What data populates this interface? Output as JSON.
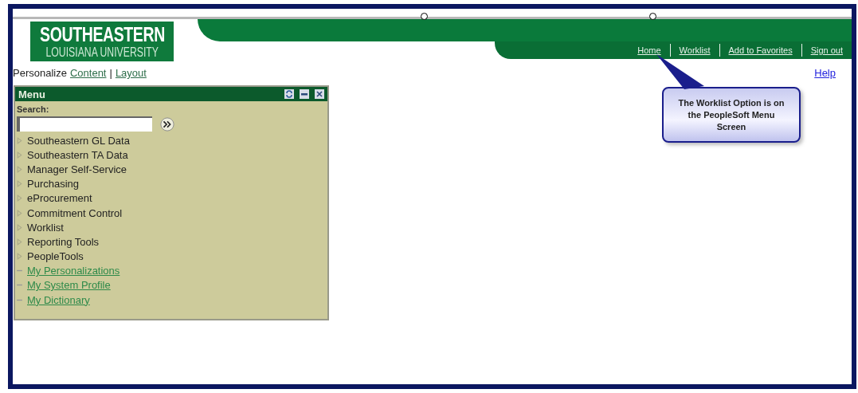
{
  "logo": {
    "title": "SOUTHEASTERN",
    "subtitle": "LOUISIANA UNIVERSITY"
  },
  "nav_links": [
    "Home",
    "Worklist",
    "Add to Favorites",
    "Sign out"
  ],
  "personalize": {
    "label": "Personalize",
    "links": [
      "Content",
      "Layout"
    ],
    "separator": "|"
  },
  "help_link": "Help",
  "menu": {
    "title": "Menu",
    "search": {
      "label": "Search:"
    },
    "items": [
      {
        "kind": "folder",
        "label": "Southeastern GL Data"
      },
      {
        "kind": "folder",
        "label": "Southeastern TA Data"
      },
      {
        "kind": "folder",
        "label": "Manager Self-Service"
      },
      {
        "kind": "folder",
        "label": "Purchasing"
      },
      {
        "kind": "folder",
        "label": "eProcurement"
      },
      {
        "kind": "folder",
        "label": "Commitment Control"
      },
      {
        "kind": "folder",
        "label": "Worklist"
      },
      {
        "kind": "folder",
        "label": "Reporting Tools"
      },
      {
        "kind": "folder",
        "label": "PeopleTools"
      },
      {
        "kind": "link",
        "label": "My Personalizations"
      },
      {
        "kind": "link",
        "label": "My System Profile"
      },
      {
        "kind": "link",
        "label": "My Dictionary"
      }
    ]
  },
  "callout": {
    "text": "The Worklist Option is on the PeopleSoft Menu Screen"
  }
}
